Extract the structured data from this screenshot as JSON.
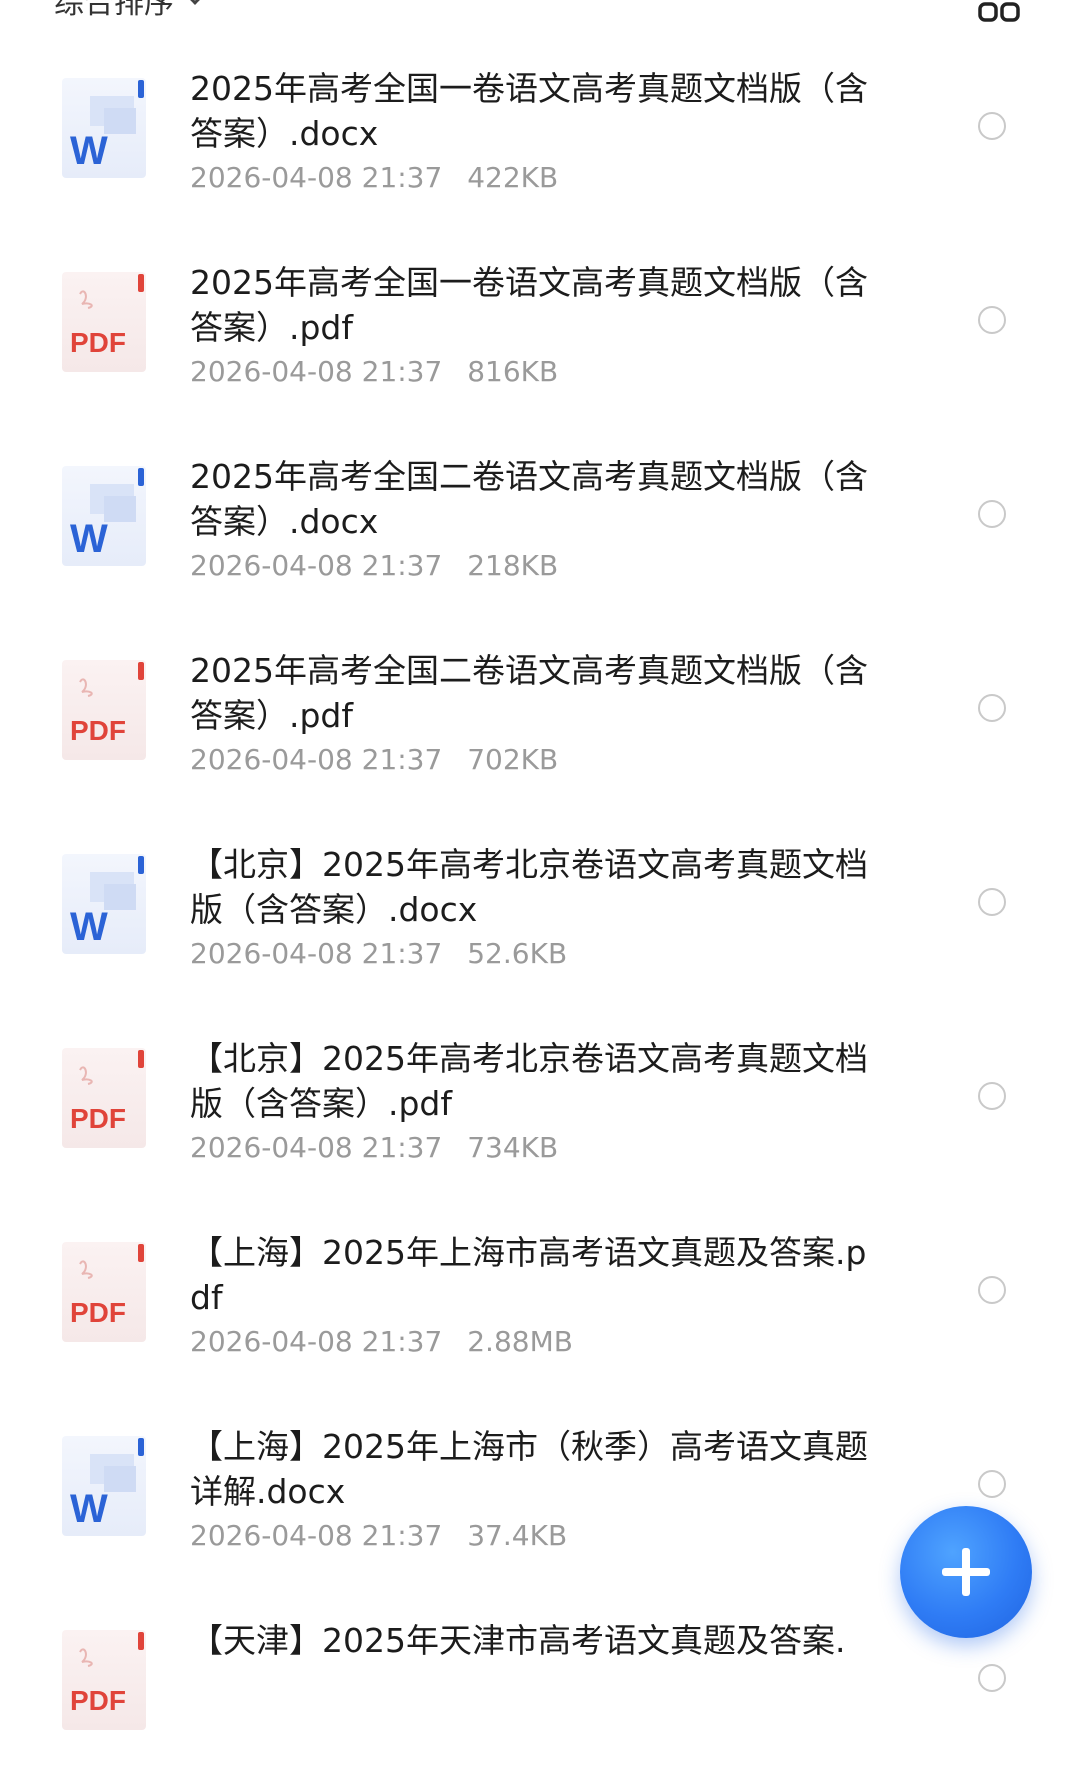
{
  "toolbar": {
    "sort_label": "综合排序",
    "sort_icon": "chevron-down-icon",
    "view_icon": "grid-view-icon"
  },
  "colors": {
    "word_blue": "#2b63d6",
    "pdf_red": "#e0443a",
    "fab_blue": "#2f7cf5",
    "meta_gray": "#9a9a9a"
  },
  "files": [
    {
      "name": "2025年高考全国一卷语文高考真题文档版（含答案）.docx",
      "type": "word",
      "date": "2026-04-08 21:37",
      "size": "422KB"
    },
    {
      "name": "2025年高考全国一卷语文高考真题文档版（含答案）.pdf",
      "type": "pdf",
      "date": "2026-04-08 21:37",
      "size": "816KB"
    },
    {
      "name": "2025年高考全国二卷语文高考真题文档版（含答案）.docx",
      "type": "word",
      "date": "2026-04-08 21:37",
      "size": "218KB"
    },
    {
      "name": "2025年高考全国二卷语文高考真题文档版（含答案）.pdf",
      "type": "pdf",
      "date": "2026-04-08 21:37",
      "size": "702KB"
    },
    {
      "name": "【北京】2025年高考北京卷语文高考真题文档版（含答案）.docx",
      "type": "word",
      "date": "2026-04-08 21:37",
      "size": "52.6KB"
    },
    {
      "name": "【北京】2025年高考北京卷语文高考真题文档版（含答案）.pdf",
      "type": "pdf",
      "date": "2026-04-08 21:37",
      "size": "734KB"
    },
    {
      "name": "【上海】2025年上海市高考语文真题及答案.pdf",
      "type": "pdf",
      "date": "2026-04-08 21:37",
      "size": "2.88MB"
    },
    {
      "name": "【上海】2025年上海市（秋季）高考语文真题详解.docx",
      "type": "word",
      "date": "2026-04-08 21:37",
      "size": "37.4KB"
    },
    {
      "name": "【天津】2025年天津市高考语文真题及答案.",
      "type": "pdf",
      "date": "",
      "size": ""
    }
  ],
  "fab": {
    "icon": "plus-icon"
  }
}
